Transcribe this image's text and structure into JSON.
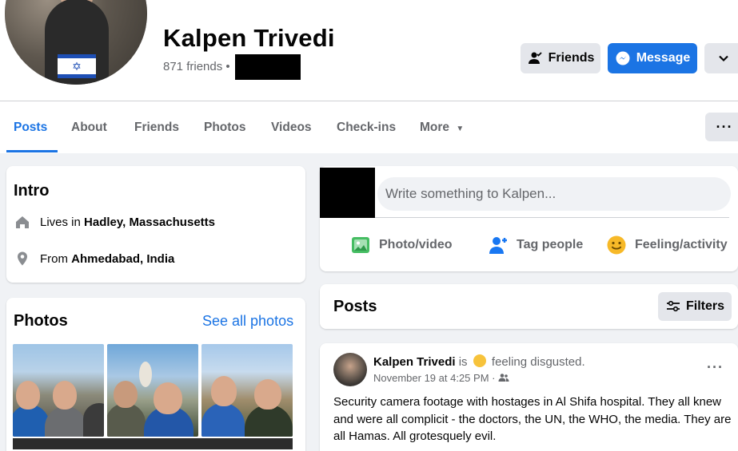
{
  "profile": {
    "name": "Kalpen Trivedi",
    "friends_count": "871 friends",
    "separator": "•"
  },
  "header_buttons": {
    "friends": "Friends",
    "message": "Message",
    "more_icon": "chevron-down-icon"
  },
  "tabs": [
    {
      "label": "Posts",
      "active": true
    },
    {
      "label": "About"
    },
    {
      "label": "Friends"
    },
    {
      "label": "Photos"
    },
    {
      "label": "Videos"
    },
    {
      "label": "Check-ins"
    },
    {
      "label": "More"
    }
  ],
  "intro": {
    "title": "Intro",
    "lives_prefix": "Lives in",
    "lives_city": "Hadley, Massachusetts",
    "from_prefix": "From",
    "from_city": "Ahmedabad, India"
  },
  "photos": {
    "title": "Photos",
    "see_all": "See all photos"
  },
  "composer": {
    "placeholder": "Write something to Kalpen...",
    "actions": [
      {
        "label": "Photo/video",
        "icon": "photo-icon",
        "color": "#45bd62"
      },
      {
        "label": "Tag people",
        "icon": "tag-people-icon",
        "color": "#1877f2"
      },
      {
        "label": "Feeling/activity",
        "icon": "feeling-icon",
        "color": "#f7b928"
      }
    ]
  },
  "posts_section": {
    "title": "Posts",
    "filters": "Filters"
  },
  "post": {
    "author": "Kalpen Trivedi",
    "is_text": "is",
    "feeling": "feeling disgusted.",
    "timestamp": "November 19 at 4:25 PM",
    "meta_sep": "·",
    "body": "Security camera footage with hostages in Al Shifa hospital. They all knew and were all complicit - the doctors, the UN, the WHO, the media. They are all Hamas.  All grotesquely evil."
  },
  "colors": {
    "accent": "#1b74e4",
    "muted_text": "#65676b",
    "button_gray": "#e4e6eb",
    "page_bg": "#f0f2f5"
  }
}
